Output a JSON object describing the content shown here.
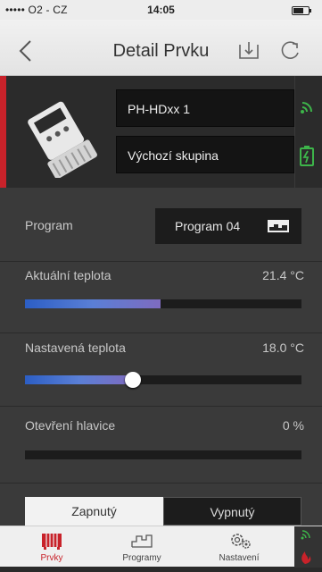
{
  "status_bar": {
    "carrier": "••••• O2 - CZ",
    "time": "14:05",
    "battery_level": 0.7
  },
  "nav": {
    "title": "Detail Prvku"
  },
  "device": {
    "name": "PH-HDxx 1",
    "group": "Výchozí skupina"
  },
  "program": {
    "label": "Program",
    "value": "Program 04"
  },
  "current_temp": {
    "label": "Aktuální teplota",
    "value": "21.4 °C",
    "level": 0.49
  },
  "set_temp": {
    "label": "Nastavená teplota",
    "value": "18.0 °C",
    "level": 0.39
  },
  "valve": {
    "label": "Otevření hlavice",
    "value": "0 %",
    "level": 0.0
  },
  "toggle": {
    "on_label": "Zapnutý",
    "off_label": "Vypnutý"
  },
  "tabs": [
    {
      "label": "Prvky"
    },
    {
      "label": "Programy"
    },
    {
      "label": "Nastavení"
    }
  ],
  "colors": {
    "accent_red": "#c8222a",
    "status_green": "#3db54a",
    "slider_blue": "#2c5ec4"
  }
}
